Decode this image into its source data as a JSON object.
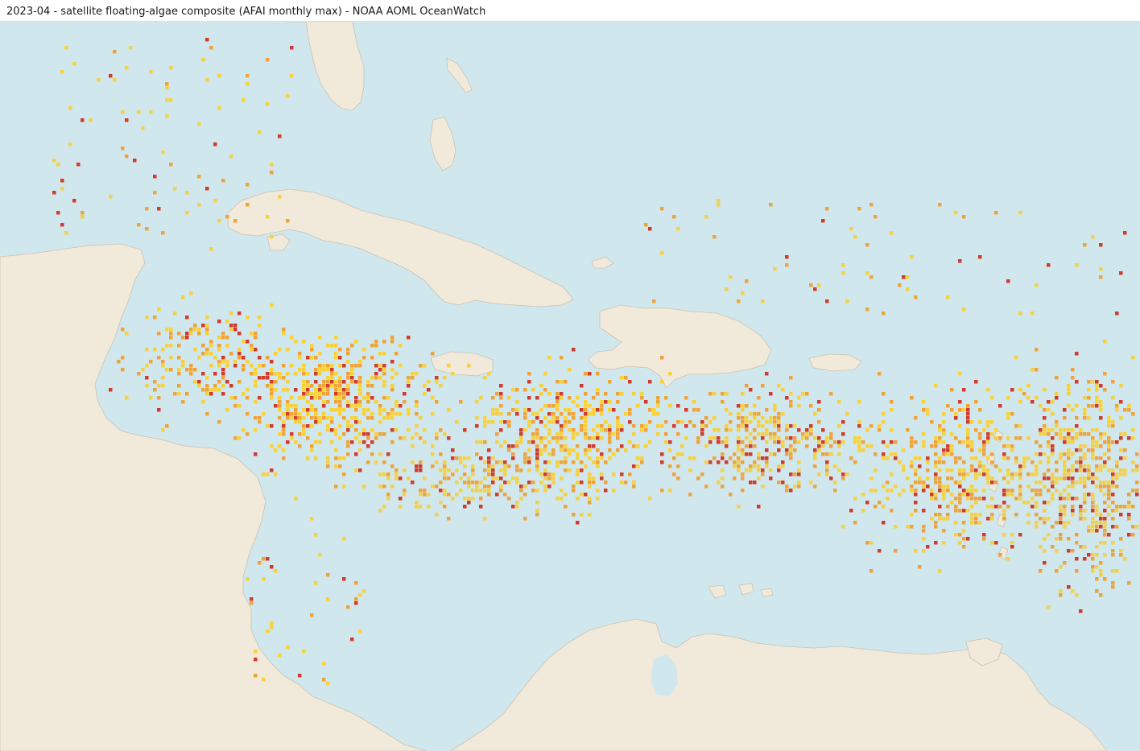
{
  "title": "2023-04 - satellite floating-algae composite (AFAI monthly max) - NOAA AOML OceanWatch",
  "colors": {
    "ocean": "#d1e7ee",
    "land": "#f1e9da",
    "coast": "#c9c2b2",
    "algae_low": "#f7d23c",
    "algae_mid": "#eea43a",
    "algae_high": "#d13b2e"
  },
  "layers": [
    "ocean",
    "land",
    "floating-algae-pixels"
  ],
  "grid_seed": 20230401
}
